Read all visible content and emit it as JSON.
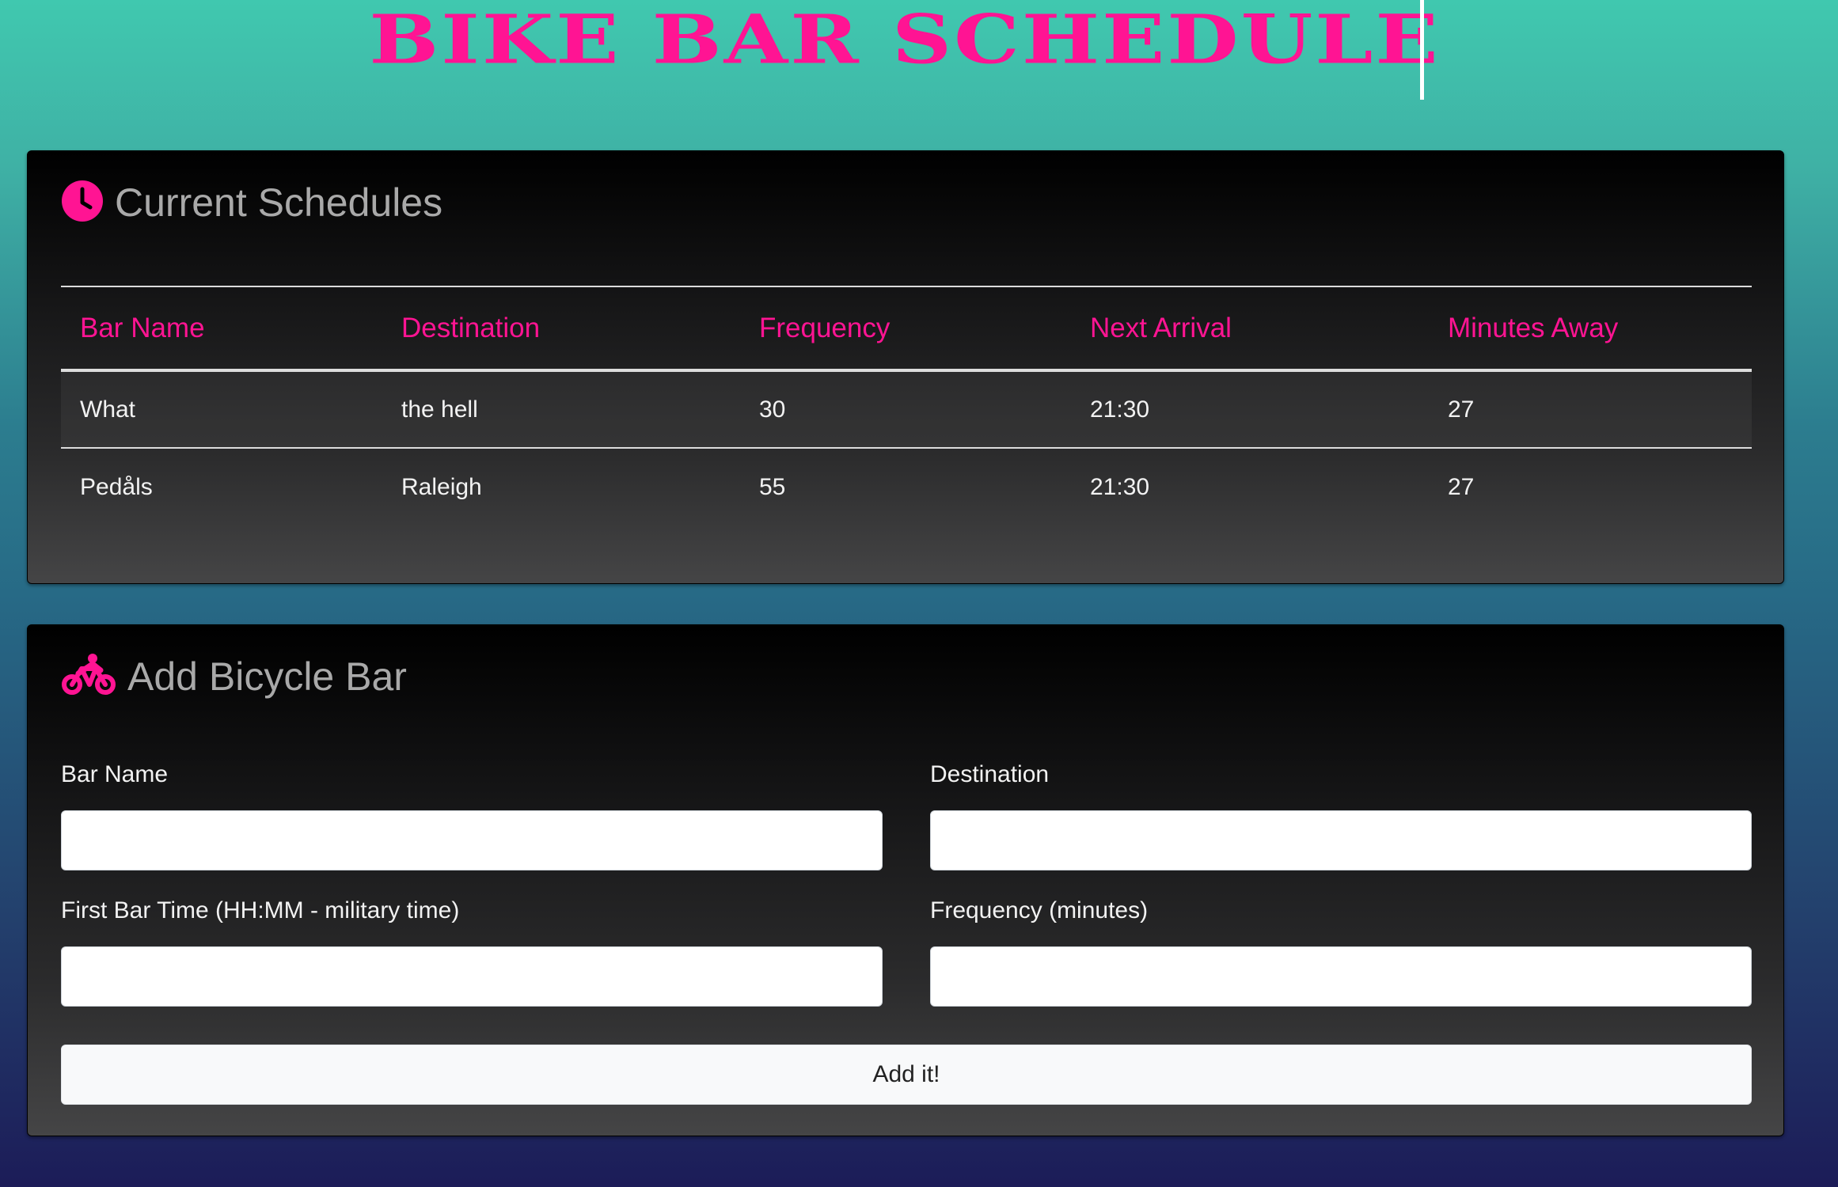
{
  "header": {
    "title": "BIKE BAR SCHEDULE"
  },
  "colors": {
    "accent": "#ff1493",
    "card_title": "#a9a9a9"
  },
  "schedules": {
    "title": "Current Schedules",
    "icon": "clock-icon",
    "columns": [
      "Bar Name",
      "Destination",
      "Frequency",
      "Next Arrival",
      "Minutes Away"
    ],
    "rows": [
      [
        "What",
        "the hell",
        "30",
        "21:30",
        "27"
      ],
      [
        "Pedåls",
        "Raleigh",
        "55",
        "21:30",
        "27"
      ]
    ]
  },
  "add_form": {
    "title": "Add Bicycle Bar",
    "icon": "bicycle-icon",
    "fields": {
      "bar_name": {
        "label": "Bar Name",
        "value": ""
      },
      "destination": {
        "label": "Destination",
        "value": ""
      },
      "first_time": {
        "label": "First Bar Time (HH:MM - military time)",
        "value": ""
      },
      "frequency": {
        "label": "Frequency (minutes)",
        "value": ""
      }
    },
    "submit_label": "Add it!"
  }
}
